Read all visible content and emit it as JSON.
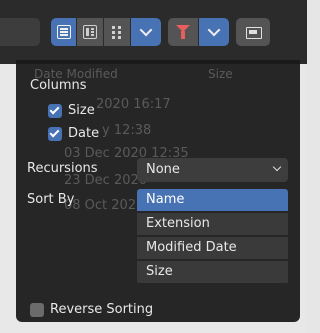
{
  "columns_label": "Columns",
  "checkboxes": [
    {
      "label": "Size",
      "checked": true
    },
    {
      "label": "Date",
      "checked": true
    }
  ],
  "recursions": {
    "label": "Recursions",
    "value": "None"
  },
  "sort_by": {
    "label": "Sort By",
    "options": [
      "Name",
      "Extension",
      "Modified Date",
      "Size"
    ],
    "selected": "Name"
  },
  "reverse_sorting": {
    "label": "Reverse Sorting",
    "checked": false
  },
  "background_list": {
    "headers": [
      "Date Modified",
      "Size"
    ],
    "dates": [
      "2020 16:17",
      "y 12:38",
      "03 Dec 2020 12:35",
      "23 Dec 2020",
      "08 Oct 2020"
    ]
  },
  "icons": [
    "view-list-icon",
    "view-thumbnail-icon",
    "view-grid-icon",
    "chevron-down-icon",
    "filter-icon",
    "folder-icon"
  ],
  "colors": {
    "accent": "#4772b3",
    "panel": "#1a1a1a",
    "toolbar": "#2b2b2b"
  }
}
